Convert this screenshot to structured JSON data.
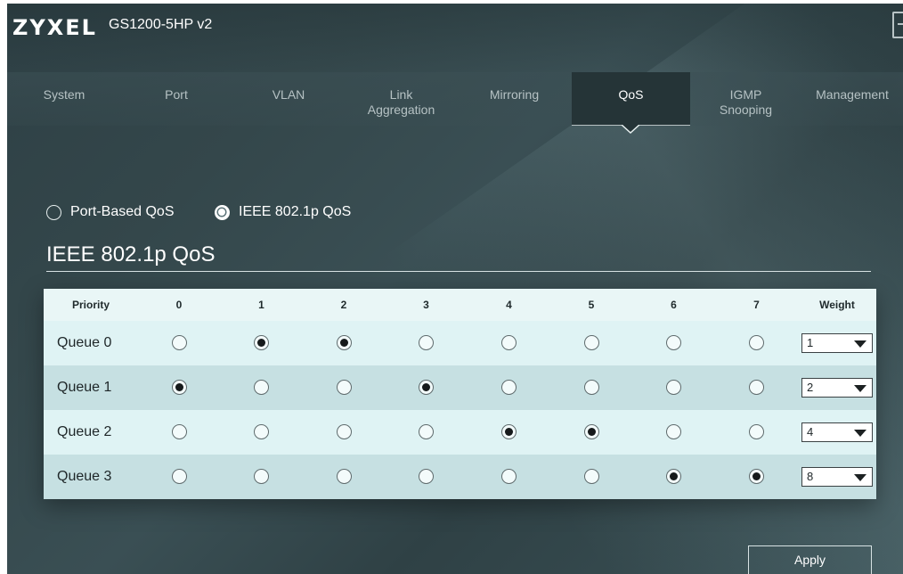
{
  "header": {
    "brand": "ZYXEL",
    "model": "GS1200-5HP v2",
    "logout_icon": "logout-icon"
  },
  "nav": {
    "items": [
      {
        "label": "System"
      },
      {
        "label": "Port"
      },
      {
        "label": "VLAN"
      },
      {
        "label": "Link\nAggregation"
      },
      {
        "label": "Mirroring"
      },
      {
        "label": "QoS",
        "active": true
      },
      {
        "label": "IGMP\nSnooping"
      },
      {
        "label": "Management"
      }
    ]
  },
  "mode": {
    "port_based": "Port-Based QoS",
    "ieee": "IEEE 802.1p QoS",
    "selected": "IEEE 802.1p QoS"
  },
  "section_title": "IEEE 802.1p QoS",
  "table": {
    "headers": [
      "Priority",
      "0",
      "1",
      "2",
      "3",
      "4",
      "5",
      "6",
      "7",
      "Weight"
    ],
    "rows": [
      {
        "label": "Queue 0",
        "priorities": [
          0,
          1,
          1,
          0,
          0,
          0,
          0,
          0
        ],
        "weight": "1"
      },
      {
        "label": "Queue 1",
        "priorities": [
          1,
          0,
          0,
          1,
          0,
          0,
          0,
          0
        ],
        "weight": "2"
      },
      {
        "label": "Queue 2",
        "priorities": [
          0,
          0,
          0,
          0,
          1,
          1,
          0,
          0
        ],
        "weight": "4"
      },
      {
        "label": "Queue 3",
        "priorities": [
          0,
          0,
          0,
          0,
          0,
          0,
          1,
          1
        ],
        "weight": "8"
      }
    ]
  },
  "apply_label": "Apply",
  "colors": {
    "background": "#34474b",
    "nav_active": "#253437",
    "table_header": "#e9f6f6",
    "row_light": "#dff3f4",
    "row_dark": "#c6e0e2"
  }
}
